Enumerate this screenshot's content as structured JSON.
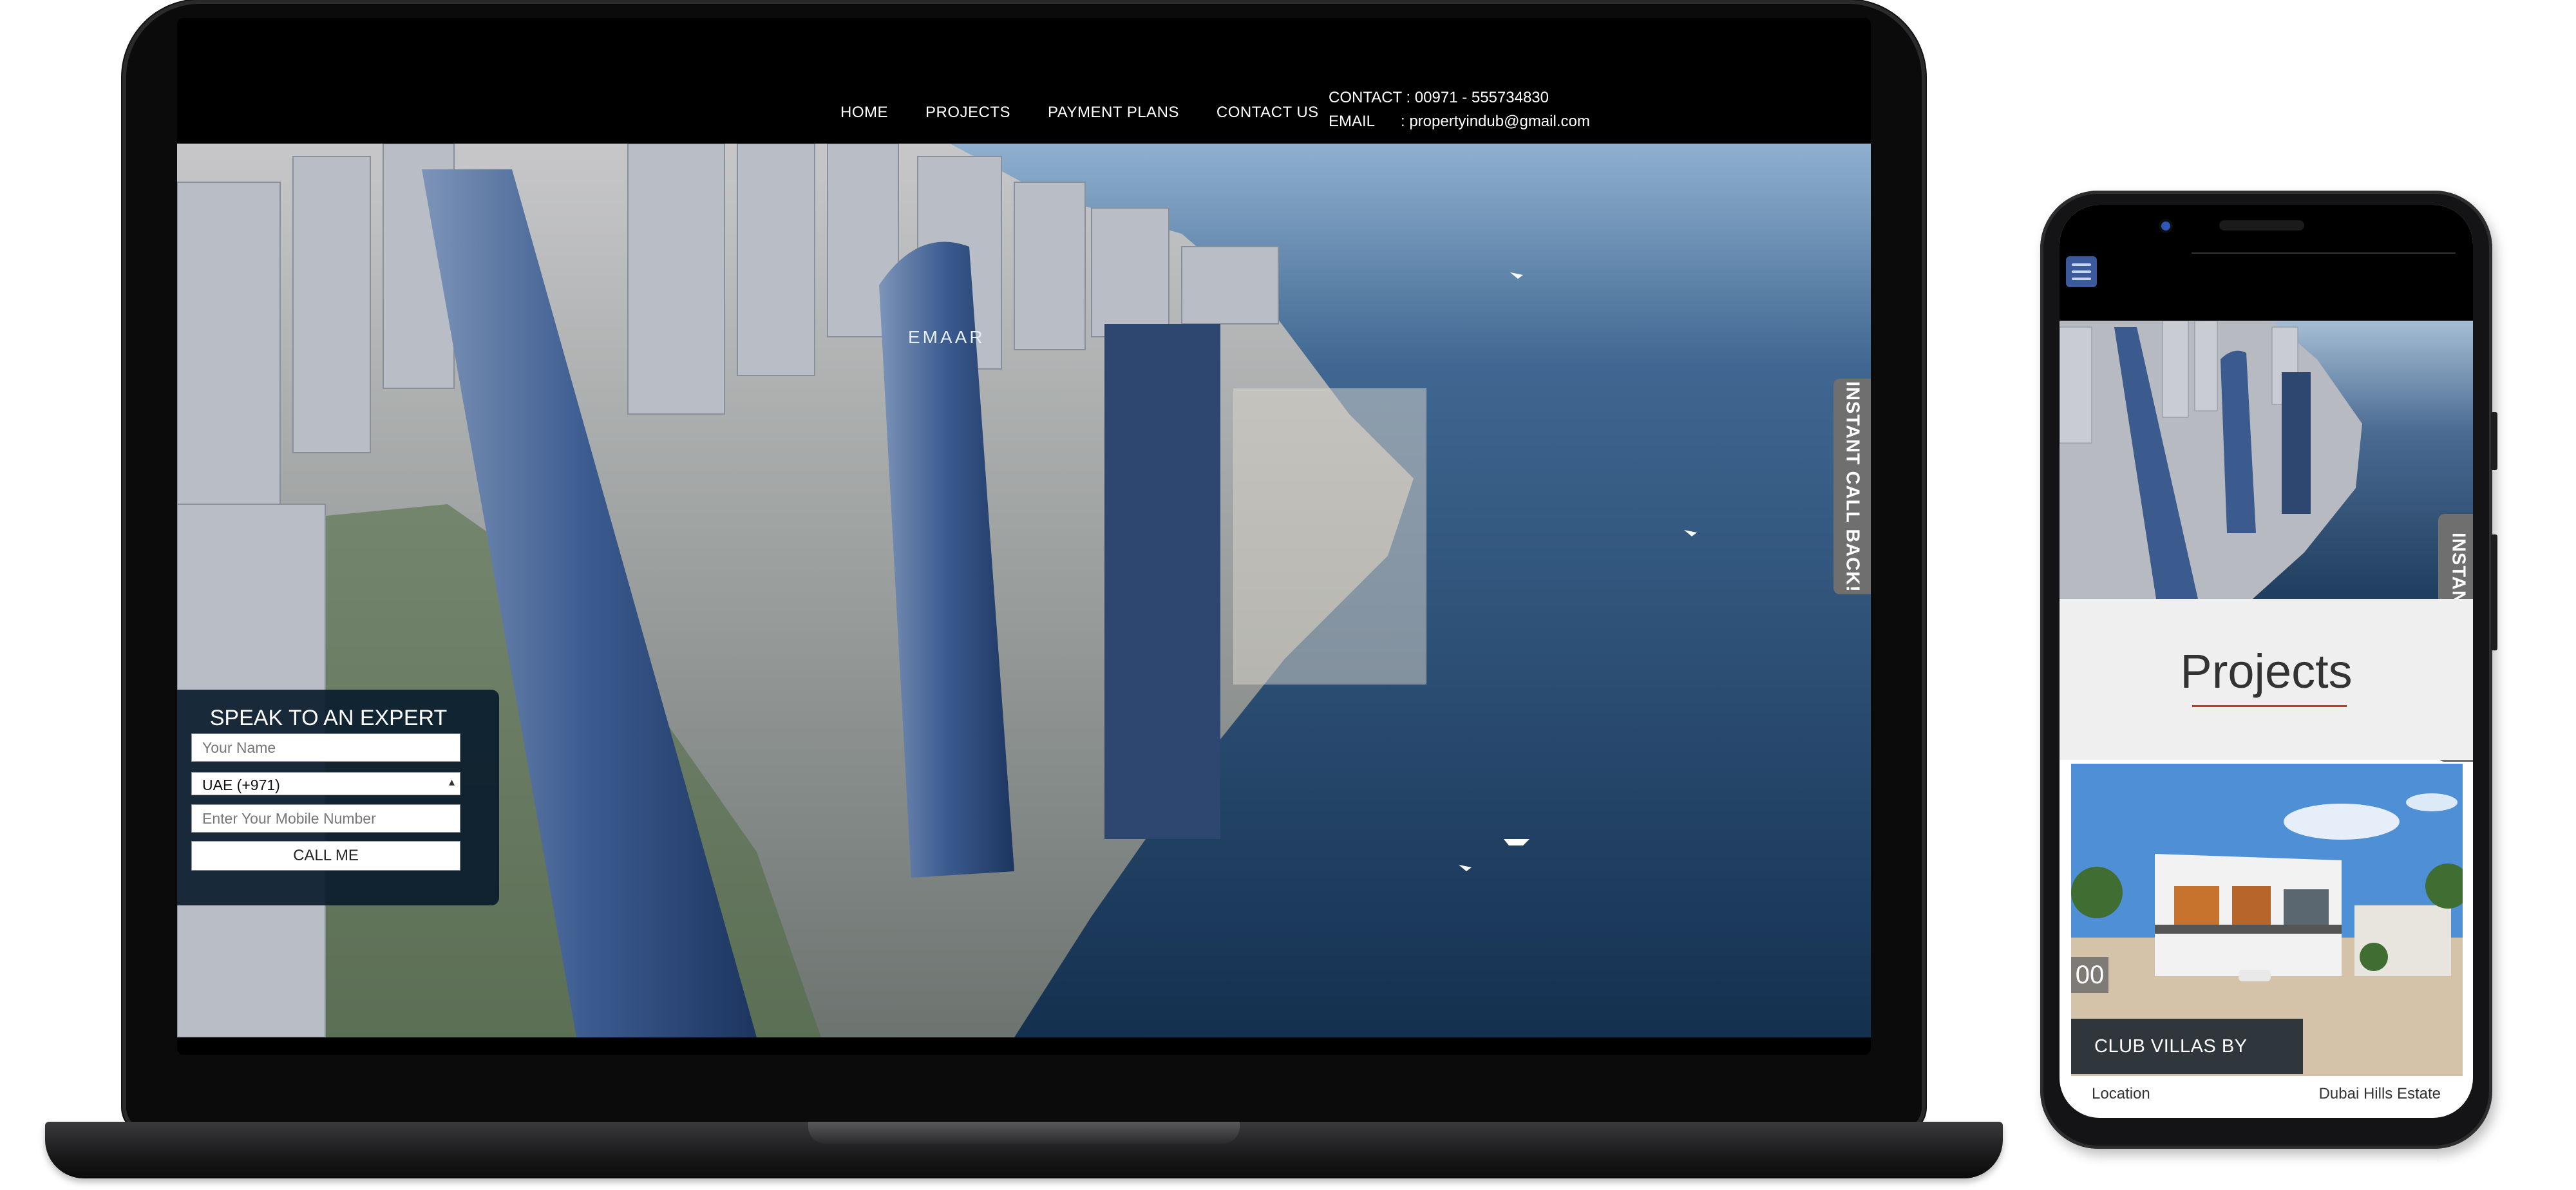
{
  "laptop": {
    "nav": {
      "home": "HOME",
      "projects": "PROJECTS",
      "payment_plans": "PAYMENT PLANS",
      "contact_us": "CONTACT US"
    },
    "contact": {
      "phone_label": "CONTACT :",
      "phone_value": "00971 - 555734830",
      "email_label": "EMAIL",
      "email_value": ": propertyindub@gmail.com"
    },
    "hero": {
      "tower_brand": "EMAAR"
    },
    "call_back_tab": "INSTANT CALL BACK!",
    "expert_form": {
      "title": "SPEAK TO AN EXPERT",
      "name_placeholder": "Your Name",
      "country_code": "UAE (+971)",
      "mobile_placeholder": "Enter Your Mobile Number",
      "submit_label": "CALL ME"
    }
  },
  "phone": {
    "call_back_tab": "INSTANT CALL BACK!",
    "projects_heading": "Projects",
    "project_card": {
      "badge": "00",
      "title": "CLUB VILLAS BY EMAAR"
    },
    "location_row": {
      "label": "Location",
      "value": "Dubai Hills Estate"
    }
  }
}
